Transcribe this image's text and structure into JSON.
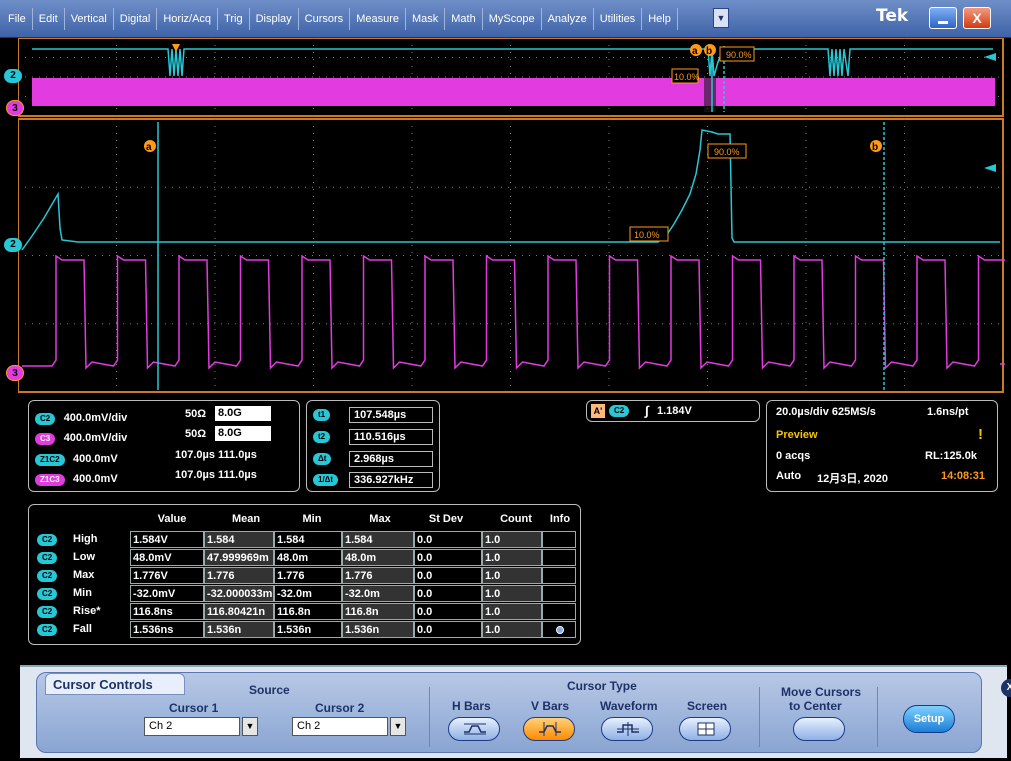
{
  "menu": [
    "File",
    "Edit",
    "Vertical",
    "Digital",
    "Horiz/Acq",
    "Trig",
    "Display",
    "Cursors",
    "Measure",
    "Mask",
    "Math",
    "MyScope",
    "Analyze",
    "Utilities",
    "Help"
  ],
  "brand": "Tek",
  "display": {
    "ch2_marker": "2",
    "ch3_marker": "3",
    "cursor_a": "a",
    "cursor_b": "b",
    "label_10": "10.0%",
    "label_90": "90.0%",
    "trigger_marker": "T",
    "colors": {
      "ch2": "#27c7d6",
      "ch3": "#e23be0",
      "grid": "#7a7a7a",
      "frame": "#c87a2a",
      "marker_orange": "#ff9a1a"
    }
  },
  "channels": [
    {
      "chip": "C2",
      "scale": "400.0mV/div",
      "imp": "50Ω",
      "bw": "8.0G"
    },
    {
      "chip": "C3",
      "scale": "400.0mV/div",
      "imp": "50Ω",
      "bw": "8.0G"
    },
    {
      "chip": "Z1C2",
      "scale": "400.0mV",
      "range": "107.0µs 111.0µs"
    },
    {
      "chip": "Z1C3",
      "scale": "400.0mV",
      "range": "107.0µs 111.0µs"
    }
  ],
  "cursor_readout": [
    {
      "label": "t1",
      "value": "107.548µs"
    },
    {
      "label": "t2",
      "value": "110.516µs"
    },
    {
      "label": "Δt",
      "value": "2.968µs"
    },
    {
      "label": "1/Δt",
      "value": "336.927kHz"
    }
  ],
  "trigger": {
    "a_badge": "A'",
    "chip": "C2",
    "level": "1.184V"
  },
  "horizontal": {
    "timebase": "20.0µs/div 625MS/s",
    "resolution": "1.6ns/pt",
    "mode": "Preview",
    "acqs": "0 acqs",
    "rl": "RL:125.0k",
    "run": "Auto",
    "date": "12月3日, 2020",
    "time": "14:08:31"
  },
  "measurements": {
    "headers": [
      "Value",
      "Mean",
      "Min",
      "Max",
      "St Dev",
      "Count",
      "Info"
    ],
    "rows": [
      {
        "chip": "C2",
        "name": "High",
        "value": "1.584V",
        "mean": "1.584",
        "min": "1.584",
        "max": "1.584",
        "stdev": "0.0",
        "count": "1.0"
      },
      {
        "chip": "C2",
        "name": "Low",
        "value": "48.0mV",
        "mean": "47.999969m",
        "min": "48.0m",
        "max": "48.0m",
        "stdev": "0.0",
        "count": "1.0"
      },
      {
        "chip": "C2",
        "name": "Max",
        "value": "1.776V",
        "mean": "1.776",
        "min": "1.776",
        "max": "1.776",
        "stdev": "0.0",
        "count": "1.0"
      },
      {
        "chip": "C2",
        "name": "Min",
        "value": "-32.0mV",
        "mean": "-32.000033m",
        "min": "-32.0m",
        "max": "-32.0m",
        "stdev": "0.0",
        "count": "1.0"
      },
      {
        "chip": "C2",
        "name": "Rise*",
        "value": "116.8ns",
        "mean": "116.80421n",
        "min": "116.8n",
        "max": "116.8n",
        "stdev": "0.0",
        "count": "1.0"
      },
      {
        "chip": "C2",
        "name": "Fall",
        "value": "1.536ns",
        "mean": "1.536n",
        "min": "1.536n",
        "max": "1.536n",
        "stdev": "0.0",
        "count": "1.0"
      }
    ]
  },
  "cursor_controls": {
    "title": "Cursor Controls",
    "source_label": "Source",
    "cursor1_label": "Cursor 1",
    "cursor1_value": "Ch 2",
    "cursor2_label": "Cursor 2",
    "cursor2_value": "Ch 2",
    "type_label": "Cursor Type",
    "types": [
      "H Bars",
      "V Bars",
      "Waveform",
      "Screen"
    ],
    "selected_type": "V Bars",
    "move_label_1": "Move Cursors",
    "move_label_2": "to Center",
    "setup": "Setup",
    "close": "X"
  }
}
